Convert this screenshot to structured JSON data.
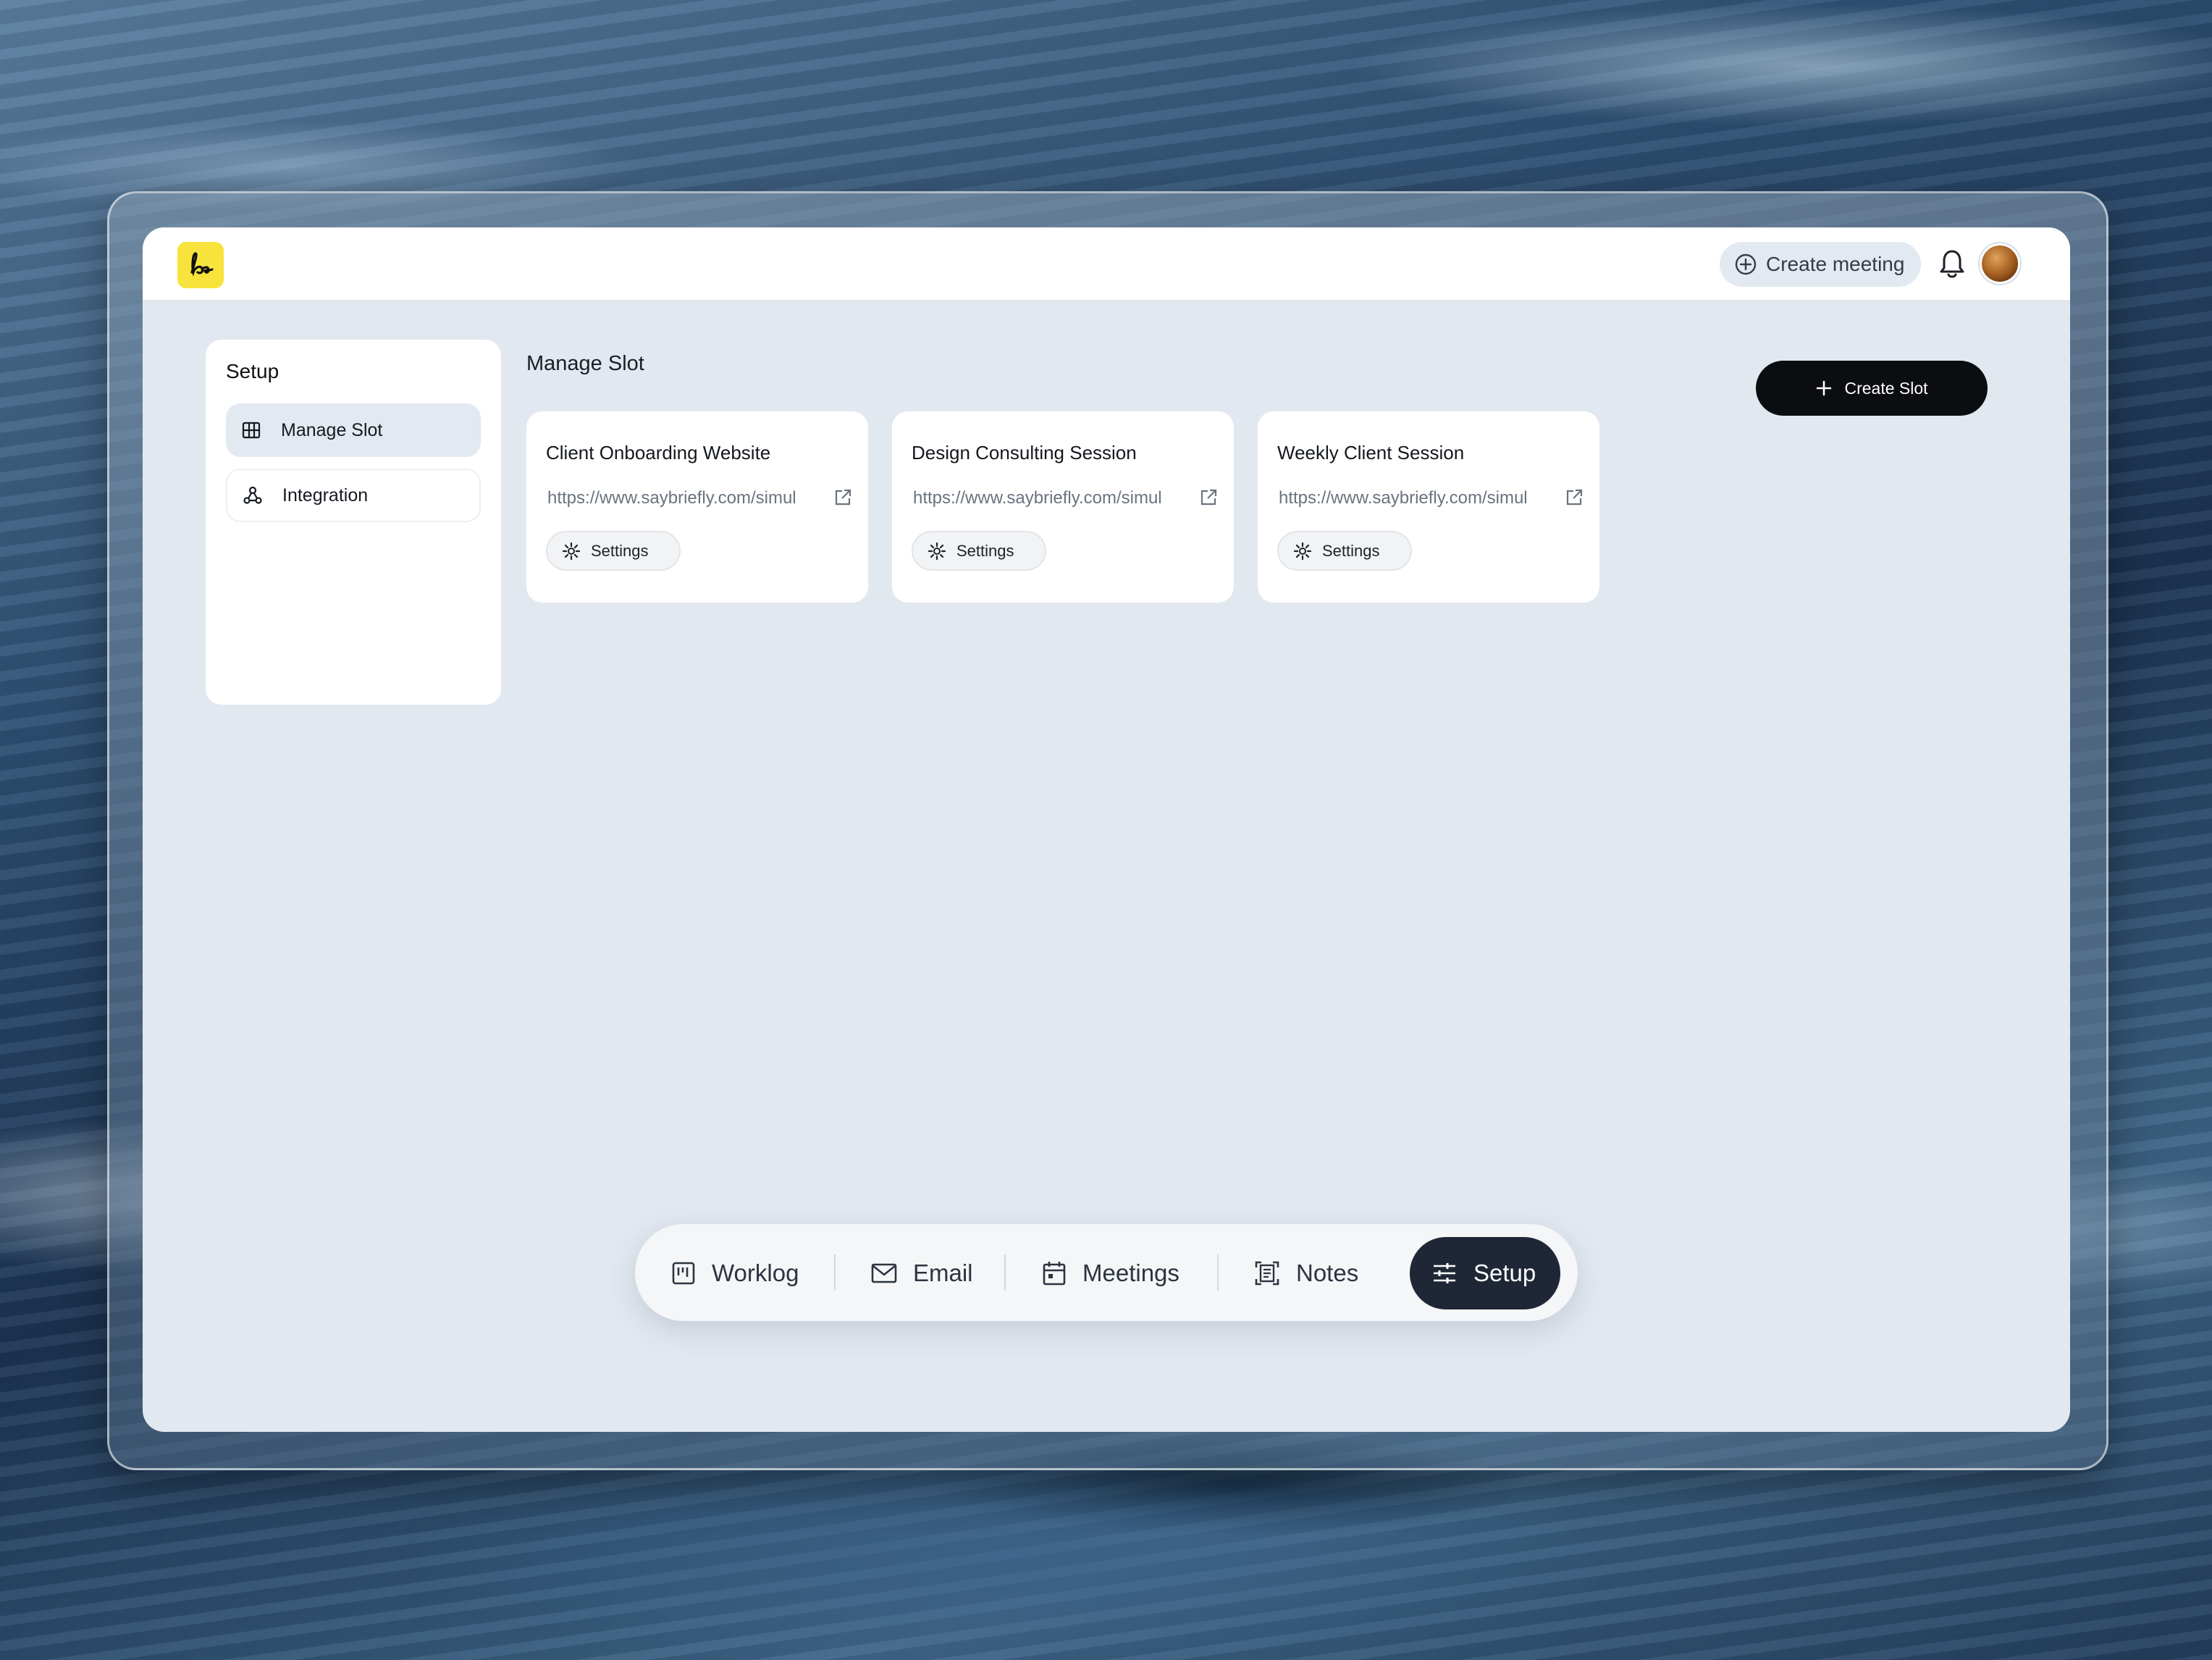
{
  "header": {
    "logo_text": "lo",
    "create_meeting_label": "Create meeting"
  },
  "sidebar": {
    "title": "Setup",
    "items": [
      {
        "label": "Manage Slot",
        "icon": "grid-icon",
        "active": true
      },
      {
        "label": "Integration",
        "icon": "integration-icon",
        "active": false
      }
    ]
  },
  "main": {
    "title": "Manage Slot",
    "create_slot_label": "Create Slot",
    "slots": [
      {
        "title": "Client Onboarding Website",
        "url": "https://www.saybriefly.com/simul",
        "settings_label": "Settings"
      },
      {
        "title": "Design Consulting Session",
        "url": "https://www.saybriefly.com/simul",
        "settings_label": "Settings"
      },
      {
        "title": "Weekly Client Session",
        "url": "https://www.saybriefly.com/simul",
        "settings_label": "Settings"
      }
    ]
  },
  "dock": {
    "items": [
      {
        "label": "Worklog",
        "icon": "worklog-icon",
        "active": false
      },
      {
        "label": "Email",
        "icon": "mail-icon",
        "active": false
      },
      {
        "label": "Meetings",
        "icon": "calendar-icon",
        "active": false
      },
      {
        "label": "Notes",
        "icon": "notes-icon",
        "active": false
      },
      {
        "label": "Setup",
        "icon": "sliders-icon",
        "active": true
      }
    ]
  },
  "colors": {
    "accent_dark": "#0b0d10",
    "dock_active": "#1f2736",
    "logo_yellow": "#f7e33b",
    "canvas": "#e2e8f0"
  }
}
